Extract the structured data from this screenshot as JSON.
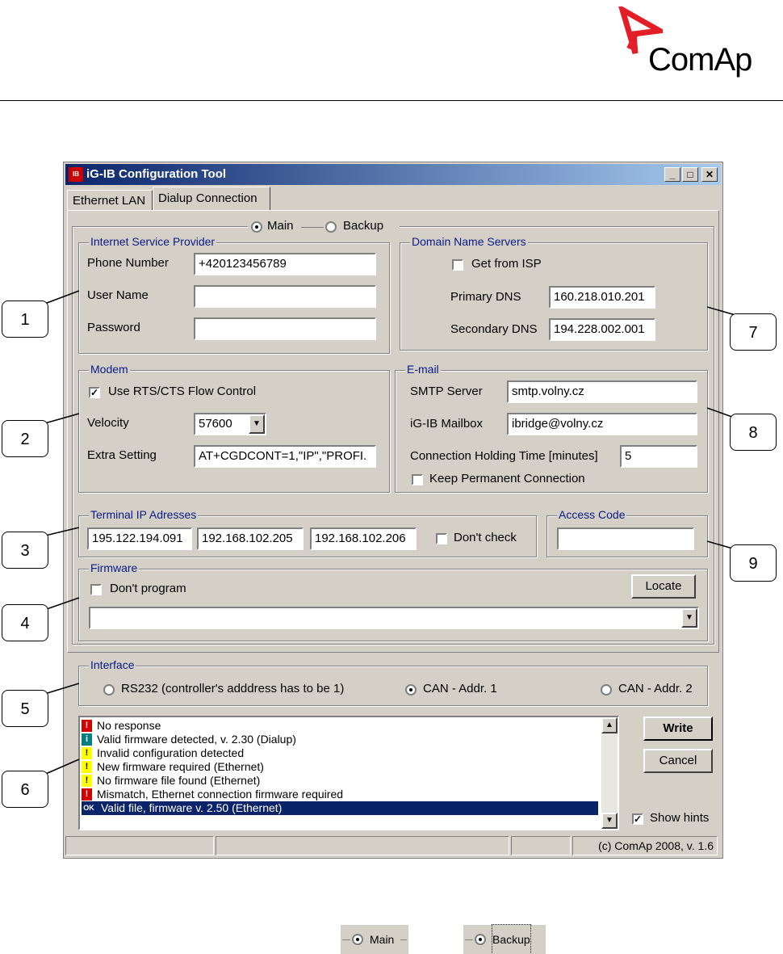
{
  "brand": {
    "name": "ComAp"
  },
  "window": {
    "title": "iG-IB Configuration Tool",
    "icon_label": "IB",
    "controls": {
      "minimize": "_",
      "maximize": "□",
      "close": "✕"
    }
  },
  "tabs": [
    {
      "label": "Ethernet LAN"
    },
    {
      "label": "Dialup Connection"
    }
  ],
  "connection_mode": {
    "main": "Main",
    "backup": "Backup"
  },
  "isp": {
    "legend": "Internet Service Provider",
    "phone_label": "Phone Number",
    "phone_value": "+420123456789",
    "user_label": "User Name",
    "user_value": "",
    "password_label": "Password",
    "password_value": ""
  },
  "dns": {
    "legend": "Domain Name Servers",
    "get_from_isp": "Get from ISP",
    "primary_label": "Primary DNS",
    "primary_value": "160.218.010.201",
    "secondary_label": "Secondary DNS",
    "secondary_value": "194.228.002.001"
  },
  "modem": {
    "legend": "Modem",
    "rts_cts": "Use RTS/CTS Flow Control",
    "velocity_label": "Velocity",
    "velocity_value": "57600",
    "extra_label": "Extra Setting",
    "extra_value": "AT+CGDCONT=1,\"IP\",\"PROFI."
  },
  "email": {
    "legend": "E-mail",
    "smtp_label": "SMTP Server",
    "smtp_value": "smtp.volny.cz",
    "mailbox_label": "iG-IB Mailbox",
    "mailbox_value": "ibridge@volny.cz",
    "holding_label": "Connection Holding Time  [minutes]",
    "holding_value": "5",
    "keep_permanent": "Keep Permanent Connection"
  },
  "terminal_ip": {
    "legend": "Terminal IP Adresses",
    "ip1": "195.122.194.091",
    "ip2": "192.168.102.205",
    "ip3": "192.168.102.206",
    "dont_check": "Don't check"
  },
  "access_code": {
    "legend": "Access Code",
    "value": ""
  },
  "firmware": {
    "legend": "Firmware",
    "dont_program": "Don't program",
    "locate": "Locate",
    "path_value": ""
  },
  "interface": {
    "legend": "Interface",
    "rs232": "RS232 (controller's adddress has to be 1)",
    "can1": "CAN - Addr. 1",
    "can2": "CAN - Addr. 2"
  },
  "log": [
    {
      "icon": "!",
      "kind": "error",
      "text": "No response"
    },
    {
      "icon": "i",
      "kind": "info",
      "text": "Valid firmware detected, v. 2.30 (Dialup)"
    },
    {
      "icon": "!",
      "kind": "warning",
      "text": "Invalid configuration detected"
    },
    {
      "icon": "!",
      "kind": "warning",
      "text": "New firmware required (Ethernet)"
    },
    {
      "icon": "!",
      "kind": "warning",
      "text": "No firmware file found (Ethernet)"
    },
    {
      "icon": "!",
      "kind": "error",
      "text": "Mismatch, Ethernet connection firmware required"
    },
    {
      "icon": "OK",
      "kind": "ok",
      "text": "Valid file, firmware v. 2.50 (Ethernet)"
    }
  ],
  "buttons": {
    "write": "Write",
    "cancel": "Cancel",
    "show_hints": "Show hints"
  },
  "status_bar": {
    "copyright": "(c) ComAp 2008, v. 1.6"
  },
  "callouts": [
    "1",
    "2",
    "3",
    "4",
    "5",
    "6",
    "7",
    "8",
    "9"
  ],
  "samples": {
    "main": "Main",
    "backup": "Backup"
  },
  "colors": {
    "window_bg": "#d4d0c8",
    "title_start": "#0a246a",
    "title_end": "#a6caf0",
    "legend_text": "#0a1a8a",
    "selection": "#0a246a",
    "logo_red": "#e41e26",
    "error_icon": "#d40000",
    "info_icon": "#008080",
    "warning_icon": "#ffff00"
  }
}
